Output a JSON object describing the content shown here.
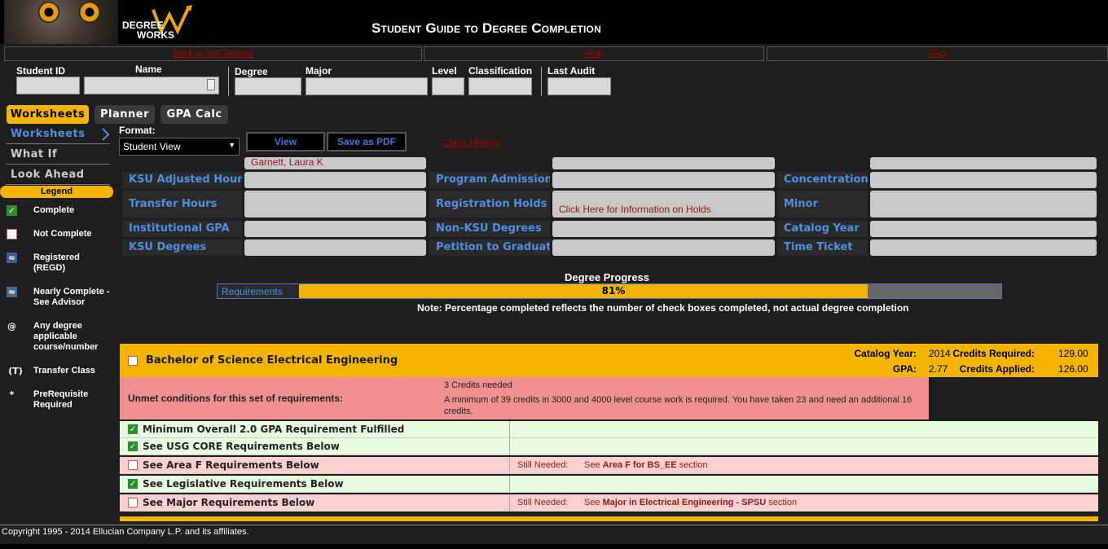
{
  "header": {
    "logo_degree": "DEGREE",
    "logo_works": "WORKS",
    "title": "Student Guide to Degree Completion"
  },
  "top_links": [
    {
      "label": "Back to Self Service"
    },
    {
      "label": "Help"
    },
    {
      "label": "FAQ"
    }
  ],
  "student_bar": {
    "student_id_label": "Student ID",
    "name_label": "Name",
    "degree_label": "Degree",
    "major_label": "Major",
    "level_label": "Level",
    "classification_label": "Classification",
    "last_audit_label": "Last Audit"
  },
  "tabs": [
    {
      "label": "Worksheets",
      "active": true
    },
    {
      "label": "Planner",
      "active": false
    },
    {
      "label": "GPA Calc",
      "active": false
    }
  ],
  "sidebar": {
    "items": [
      {
        "label": "Worksheets"
      },
      {
        "label": "What If"
      },
      {
        "label": "Look Ahead"
      }
    ],
    "legend_title": "Legend",
    "legend": [
      {
        "icon": "check-icon",
        "symbol": "✓",
        "label": "Complete"
      },
      {
        "icon": "empty-box-icon",
        "symbol": "",
        "label": "Not Complete"
      },
      {
        "icon": "registered-icon",
        "symbol": "≈",
        "label": "Registered (REGD)"
      },
      {
        "icon": "nearly-complete-icon",
        "symbol": "≈",
        "label": "Nearly Complete - See Advisor"
      },
      {
        "icon": "at-icon",
        "symbol": "@",
        "label": "Any degree applicable course/number"
      },
      {
        "icon": "transfer-icon",
        "symbol": "(T)",
        "label": "Transfer Class"
      },
      {
        "icon": "asterisk-icon",
        "symbol": "*",
        "label": "PreRequisite Required"
      }
    ]
  },
  "format": {
    "label": "Format:",
    "selected": "Student View",
    "view_label": "View",
    "save_pdf_label": "Save as PDF",
    "class_history_label": "Class History"
  },
  "info": {
    "advisor_partial": "Garnett, Laura K",
    "ksu_adjusted_hours": "KSU Adjusted Hours",
    "transfer_hours": "Transfer Hours",
    "institutional_gpa": "Institutional GPA",
    "ksu_degrees": "KSU Degrees",
    "program_admission": "Program Admission",
    "registration_holds": "Registration Holds",
    "holds_link": "Click Here for Information on Holds",
    "non_ksu_degrees": "Non-KSU Degrees",
    "petition_to_graduate": "Petition to Graduate",
    "concentration": "Concentration",
    "minor": "Minor",
    "catalog_year": "Catalog Year",
    "time_ticket": "Time Ticket"
  },
  "degree_progress": {
    "title": "Degree Progress",
    "requirements_label": "Requirements",
    "percent": 81,
    "percent_label": "81%",
    "note": "Note: Percentage completed reflects the number of check boxes completed, not actual degree completion"
  },
  "block": {
    "title": "Bachelor of Science Electrical Engineering",
    "catalog_year_label": "Catalog Year:",
    "catalog_year": "2014",
    "credits_required_label": "Credits Required:",
    "credits_required": "129.00",
    "gpa_label": "GPA:",
    "gpa": "2.77",
    "credits_applied_label": "Credits Applied:",
    "credits_applied": "126.00",
    "unmet_label": "Unmet conditions for this set of requirements:",
    "unmet_line1": "3 Credits needed",
    "unmet_line2": "A minimum of 39 credits in 3000 and 4000 level course work  is required. You have taken 23 and  need an additional 16 credits."
  },
  "requirements": [
    {
      "name": "Minimum Overall 2.0 GPA Requirement Fulfilled",
      "complete": true
    },
    {
      "name": "See USG CORE Requirements Below",
      "complete": true
    },
    {
      "name": "See Area F Requirements Below",
      "complete": false,
      "still_needed": "Still Needed:",
      "see": "See",
      "target": "Area F for BS_EE",
      "suffix": "section"
    },
    {
      "name": "See Legislative Requirements Below",
      "complete": true
    },
    {
      "name": "See Major Requirements Below",
      "complete": false,
      "still_needed": "Still Needed:",
      "see": "See",
      "target": "Major in Electrical Engineering - SPSU",
      "suffix": "section"
    }
  ],
  "footer": {
    "copyright": "Copyright 1995 - 2014 Ellucian Company L.P. and its affiliates."
  },
  "colors": {
    "accent_gold": "#f5b400",
    "link_blue": "#4f8fe0",
    "complete_green": "#e8fde0",
    "incomplete_red": "#fdd0d0",
    "unmet_red": "#f09090"
  }
}
